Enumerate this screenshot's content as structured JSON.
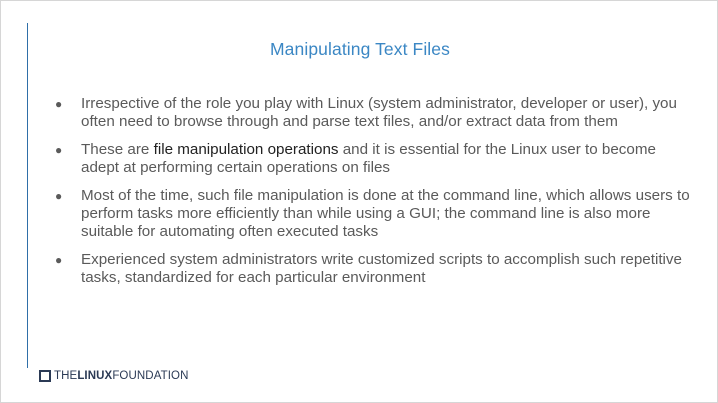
{
  "slide": {
    "title": "Manipulating Text Files",
    "bullets": [
      {
        "before": "Irrespective of the role you play with Linux (system administrator, developer or user), you often need to browse through and parse text files, and/or extract data from them",
        "strong": "",
        "after": ""
      },
      {
        "before": "These are ",
        "strong": "file manipulation operations",
        "after": " and it is essential for the Linux user to become adept at performing certain operations on files"
      },
      {
        "before": "Most of the time, such file manipulation is done at the command line, which allows users to perform tasks more efficiently than while using a GUI; the command line is also more suitable for automating often executed tasks",
        "strong": "",
        "after": ""
      },
      {
        "before": "Experienced system administrators write customized scripts to accomplish such repetitive tasks, standardized for each particular environment",
        "strong": "",
        "after": ""
      }
    ],
    "bullet_glyph": "●"
  },
  "footer": {
    "logo_prefix": "THE",
    "logo_bold": "LINUX",
    "logo_suffix": "FOUNDATION"
  },
  "colors": {
    "title": "#3b87c4",
    "body_text": "#5a5a5a",
    "emphasis": "#222222",
    "left_rule": "#2f6fa8",
    "logo": "#2b3a55"
  }
}
